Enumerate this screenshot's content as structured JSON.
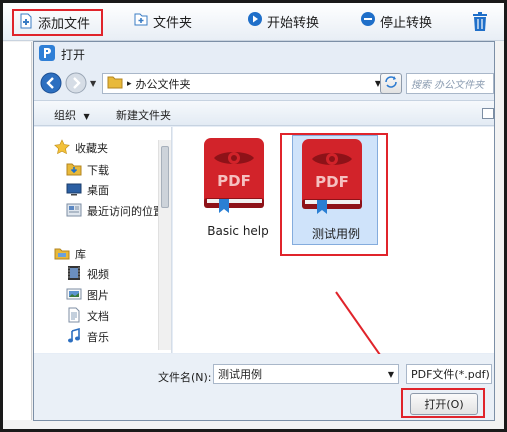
{
  "toolbar": {
    "add_file": "添加文件",
    "folder": "文件夹",
    "start": "开始转换",
    "stop": "停止转换"
  },
  "dialog": {
    "title": "打开",
    "path": "办公文件夹",
    "search_placeholder": "搜索 办公文件夹",
    "organize": "组织",
    "new_folder": "新建文件夹",
    "nav": {
      "favorites": "收藏夹",
      "downloads": "下载",
      "desktop": "桌面",
      "recent": "最近访问的位置",
      "libraries": "库",
      "videos": "视频",
      "pictures": "图片",
      "documents": "文档",
      "music": "音乐"
    },
    "files": [
      {
        "name": "Basic help",
        "badge": "PDF",
        "selected": false
      },
      {
        "name": "测试用例",
        "badge": "PDF",
        "selected": true
      }
    ],
    "filename_label": "文件名(N):",
    "filename_value": "测试用例",
    "filetype": "PDF文件(*.pdf)",
    "open_button": "打开(O)"
  },
  "colors": {
    "highlight_red": "#e0242b",
    "pdf_red": "#d2232a",
    "pdf_dark": "#8e1218",
    "bookmark_blue": "#2a7fd4",
    "selection": "#cfe3fa"
  }
}
